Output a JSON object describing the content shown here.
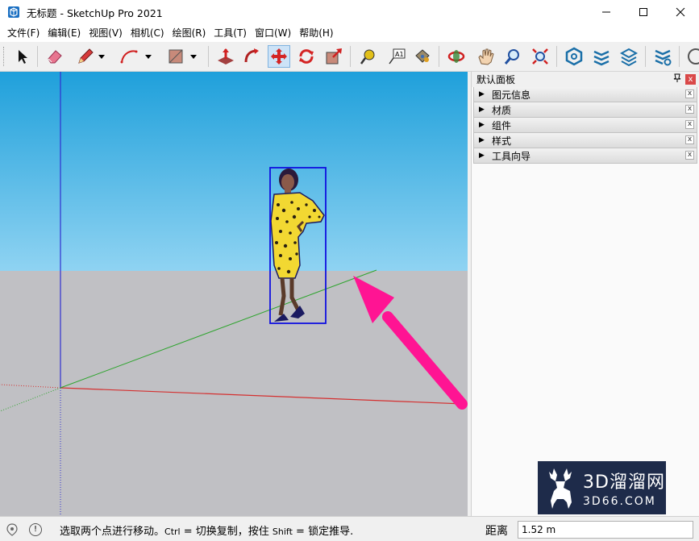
{
  "window": {
    "title": "无标题 - SketchUp Pro 2021",
    "minimize_label": "—",
    "maximize_label": "☐",
    "close_label": "✕"
  },
  "menu": [
    "文件(F)",
    "编辑(E)",
    "视图(V)",
    "相机(C)",
    "绘图(R)",
    "工具(T)",
    "窗口(W)",
    "帮助(H)"
  ],
  "toolbar": {
    "tools": [
      "select-icon",
      "eraser-icon",
      "pencil-icon",
      "arc-icon",
      "rectangle-icon",
      "push-pull-icon",
      "follow-me-icon",
      "move-icon",
      "rotate-icon",
      "scale-icon",
      "tape-measure-icon",
      "text-icon",
      "paint-bucket-icon",
      "orbit-icon",
      "pan-icon",
      "zoom-icon",
      "zoom-extents-icon",
      "warehouse-icon",
      "extension-warehouse-icon",
      "layout-icon",
      "extension-manager-icon"
    ],
    "selected": "move-icon"
  },
  "colors": {
    "sky_top": "#1fa0db",
    "sky_bottom": "#8fd3f2",
    "ground": "#c0c0c4",
    "selection_blue": "#1010e0",
    "arrow_pink": "#ff1493",
    "red_axis": "#d43030",
    "green_axis": "#2ea42e",
    "blue_axis": "#3030d0"
  },
  "panel": {
    "title": "默认面板",
    "pin_label": "ㅁ",
    "close_label": "x",
    "trays": [
      {
        "label": "图元信息",
        "close": "x"
      },
      {
        "label": "材质",
        "close": "x"
      },
      {
        "label": "组件",
        "close": "x"
      },
      {
        "label": "样式",
        "close": "x"
      },
      {
        "label": "工具向导",
        "close": "x"
      }
    ]
  },
  "status": {
    "msg_1": "选取两个点进行移动。",
    "msg_ctrl": "Ctrl",
    "msg_2": " = 切换复制，按住 ",
    "msg_shift": "Shift",
    "msg_3": " = 锁定推导.",
    "vcb_label": "距离",
    "vcb_value": "1.52 m"
  },
  "watermark": {
    "line1": "3D溜溜网",
    "line2": "3D66.COM"
  }
}
